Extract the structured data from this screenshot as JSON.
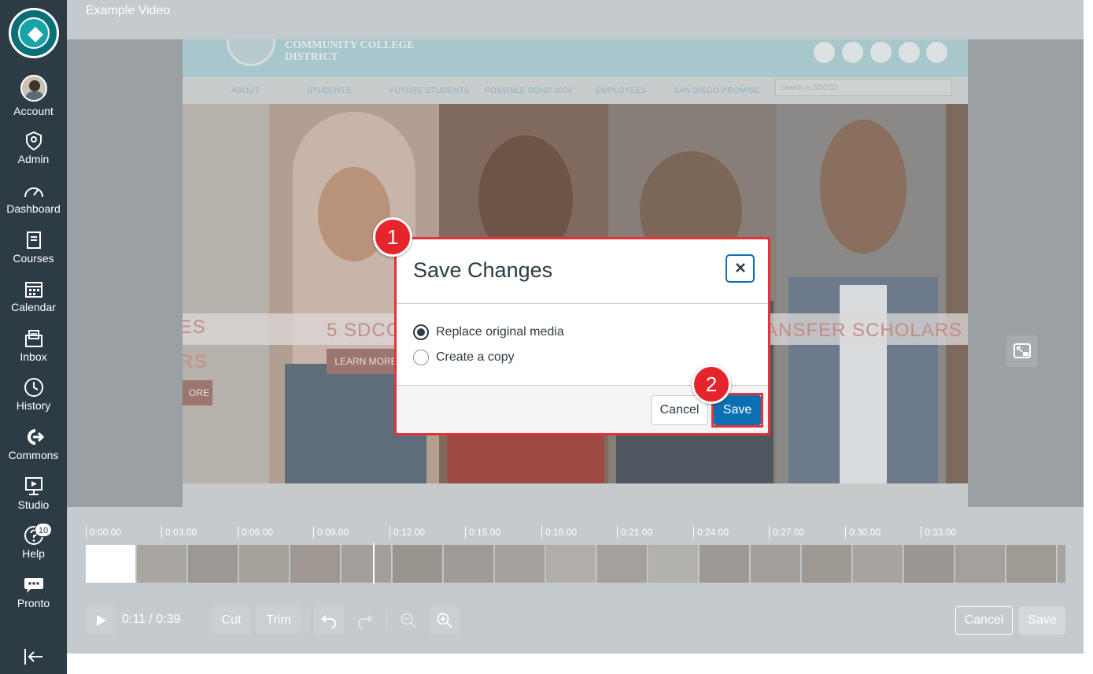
{
  "nav": {
    "items": [
      {
        "key": "account",
        "label": "Account",
        "icon": "avatar"
      },
      {
        "key": "admin",
        "label": "Admin",
        "icon": "shield-icon"
      },
      {
        "key": "dashboard",
        "label": "Dashboard",
        "icon": "speedometer-icon"
      },
      {
        "key": "courses",
        "label": "Courses",
        "icon": "book-icon"
      },
      {
        "key": "calendar",
        "label": "Calendar",
        "icon": "calendar-icon"
      },
      {
        "key": "inbox",
        "label": "Inbox",
        "icon": "inbox-icon"
      },
      {
        "key": "history",
        "label": "History",
        "icon": "clock-icon"
      },
      {
        "key": "commons",
        "label": "Commons",
        "icon": "commons-icon"
      },
      {
        "key": "studio",
        "label": "Studio",
        "icon": "studio-icon"
      },
      {
        "key": "help",
        "label": "Help",
        "icon": "help-icon",
        "badge": "10"
      },
      {
        "key": "pronto",
        "label": "Pronto",
        "icon": "chat-icon"
      }
    ],
    "colors": {
      "background": "#2d3b45",
      "text": "#ffffff"
    }
  },
  "editor": {
    "video_title": "Example Video",
    "frame": {
      "college_name_line1": "COMMUNITY COLLEGE",
      "college_name_line2": "DISTRICT",
      "nav_links": [
        "ABOUT",
        "STUDENTS",
        "FUTURE STUDENTS",
        "POSSIBLE BOND 2024",
        "EMPLOYEES",
        "SAN DIEGO PROMISE"
      ],
      "search_placeholder": "Search in SDCCD",
      "social_icons": [
        "facebook-icon",
        "twitter-icon",
        "instagram-icon",
        "youtube-icon",
        "linkedin-icon"
      ],
      "banner_left_line1": "IES",
      "banner_left_line2": "RS",
      "banner_middle": "5 SDCC",
      "banner_right": "ANSFER SCHOLARS",
      "learn_more": "LEARN MORE",
      "more_fragment": "ORE"
    }
  },
  "timeline": {
    "ticks": [
      "0:00.00",
      "0:03.00",
      "0:06.00",
      "0:09.00",
      "0:12.00",
      "0:15.00",
      "0:18.00",
      "0:21.00",
      "0:24.00",
      "0:27.00",
      "0:30.00",
      "0:33.00"
    ],
    "current_time": "0:11",
    "duration": "0:39",
    "controls": {
      "cut": "Cut",
      "trim": "Trim",
      "cancel": "Cancel",
      "save": "Save"
    }
  },
  "modal": {
    "title": "Save Changes",
    "options": [
      {
        "label": "Replace original media",
        "checked": true
      },
      {
        "label": "Create a copy",
        "checked": false
      }
    ],
    "cancel_label": "Cancel",
    "save_label": "Save",
    "accent_color": "#0b6fb3",
    "highlight_color": "#e5323b"
  },
  "callouts": [
    "1",
    "2"
  ]
}
